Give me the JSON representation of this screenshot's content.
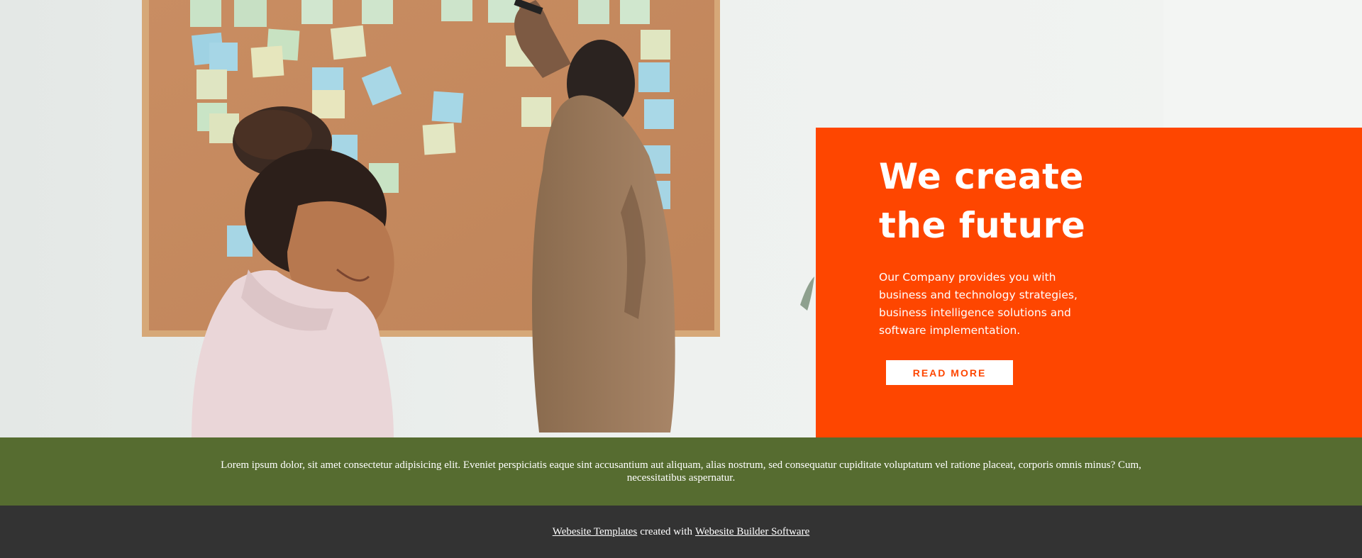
{
  "hero": {
    "title_line1": "We create",
    "title_line2": "the future",
    "description": "Our Company provides you with business and technology strategies, business intelligence solutions and software implementation.",
    "button_label": "READ MORE",
    "panel_color": "#fe4600",
    "photo": "office-team-planning-corkboard-photo"
  },
  "strip": {
    "text": "Lorem ipsum dolor, sit amet consectetur adipisicing elit. Eveniet perspiciatis eaque sint accusantium aut aliquam, alias nostrum, sed consequatur cupiditate voluptatum vel ratione placeat, corporis omnis minus? Cum, necessitatibus aspernatur.",
    "background": "#566c30"
  },
  "footer": {
    "link1": "Webesite Templates",
    "middle": "created with",
    "link2": "Webesite Builder Software",
    "background": "#333333"
  }
}
